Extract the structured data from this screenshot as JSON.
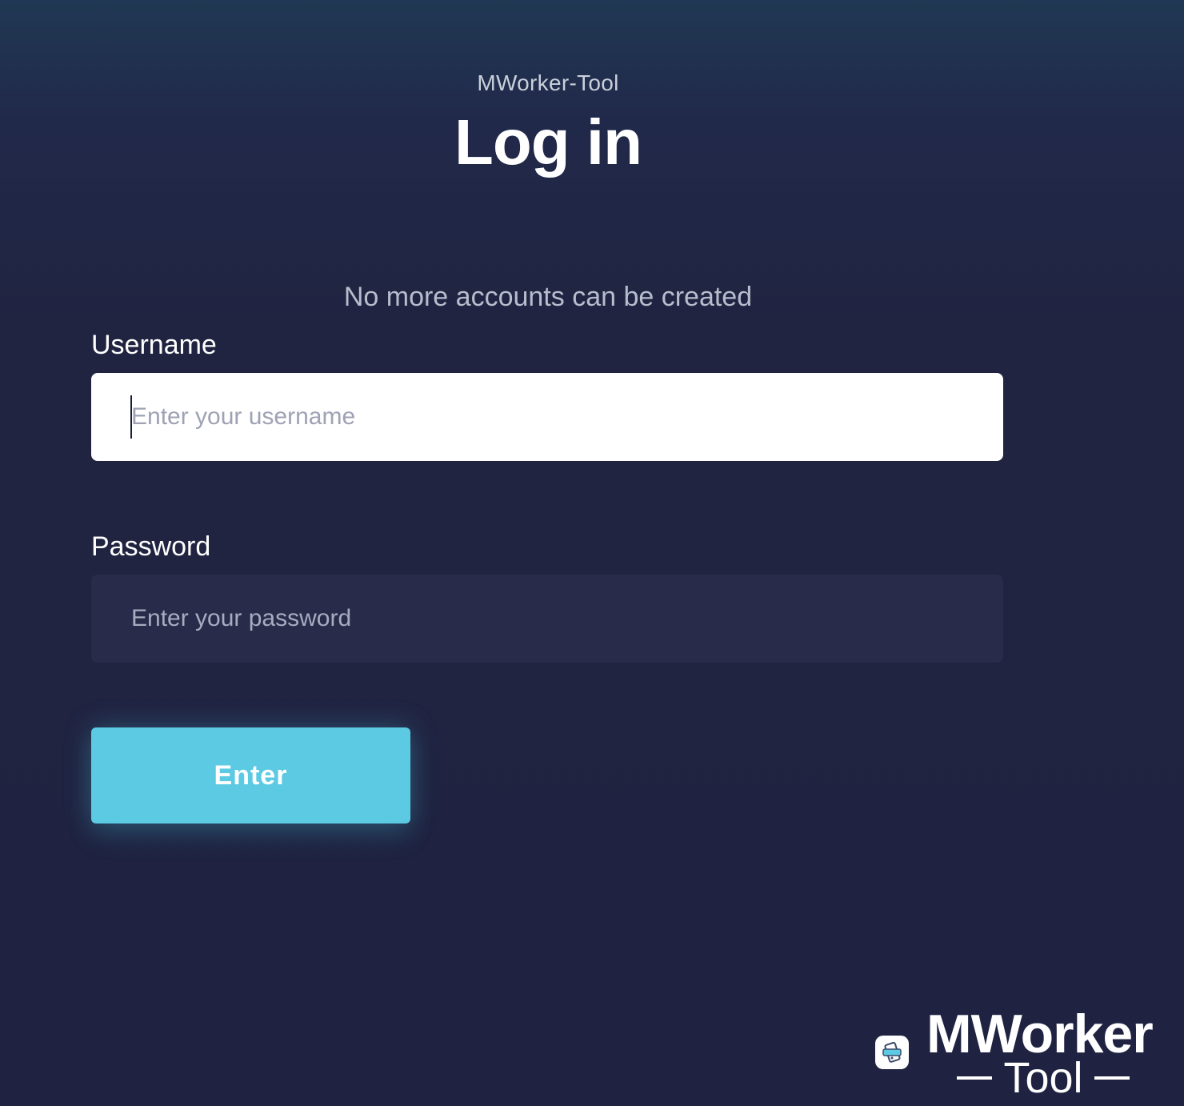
{
  "header": {
    "app_name": "MWorker-Tool",
    "title": "Log in"
  },
  "notice": "No more accounts can be created",
  "form": {
    "username_label": "Username",
    "username_placeholder": "Enter your username",
    "username_value": "",
    "password_label": "Password",
    "password_placeholder": "Enter your password",
    "password_value": "",
    "submit_label": "Enter"
  },
  "logo": {
    "main": "MWorker",
    "sub": "Tool",
    "icon": "phone-tool-icon"
  },
  "colors": {
    "background": "#21294a",
    "accent": "#5bcae2",
    "field_light": "#ffffff",
    "field_dark": "#282b4a"
  }
}
